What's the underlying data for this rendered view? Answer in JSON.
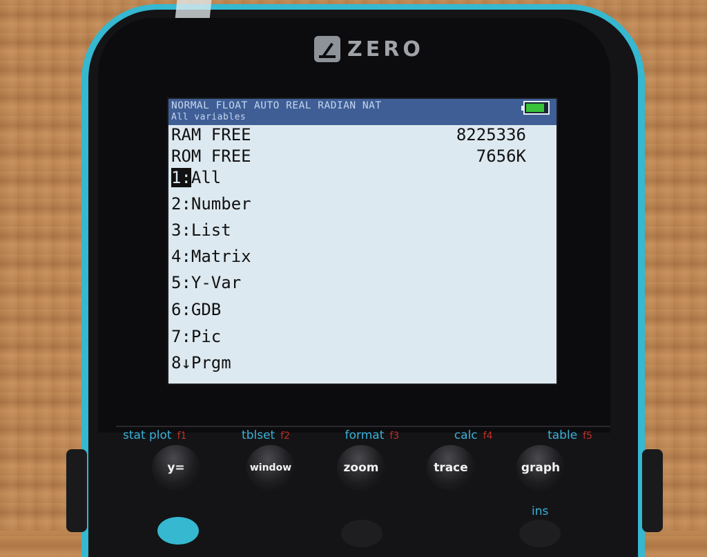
{
  "brand": {
    "name": "ZERO",
    "logo_icon": "zero-logo-icon"
  },
  "status": {
    "line1": "NORMAL FLOAT AUTO REAL RADIAN NAT",
    "line2": "All variables",
    "battery_icon": "battery-icon",
    "battery_level": 0.85
  },
  "memory": {
    "ram_label": "RAM FREE",
    "ram_value": "8225336",
    "rom_label": "ROM FREE",
    "rom_value": "7656K"
  },
  "menu": [
    {
      "num": "1:",
      "label": "All",
      "selected": true
    },
    {
      "num": "2:",
      "label": "Number"
    },
    {
      "num": "3:",
      "label": "List"
    },
    {
      "num": "4:",
      "label": "Matrix"
    },
    {
      "num": "5:",
      "label": "Y-Var"
    },
    {
      "num": "6:",
      "label": "GDB"
    },
    {
      "num": "7:",
      "label": "Pic"
    },
    {
      "num": "8↓",
      "label": "Prgm"
    }
  ],
  "function_labels": [
    {
      "label": "stat plot",
      "fkey": "f1"
    },
    {
      "label": "tblset",
      "fkey": "f2"
    },
    {
      "label": "format",
      "fkey": "f3"
    },
    {
      "label": "calc",
      "fkey": "f4"
    },
    {
      "label": "table",
      "fkey": "f5"
    }
  ],
  "keys": [
    "y=",
    "window",
    "zoom",
    "trace",
    "graph"
  ],
  "secondary_label": "ins",
  "colors": {
    "screen_bg": "#dde9f0",
    "status_bar": "#3f5e96",
    "accent_blue": "#3ab2da",
    "fkey_red": "#c03028",
    "device_trim": "#35b8d0"
  }
}
